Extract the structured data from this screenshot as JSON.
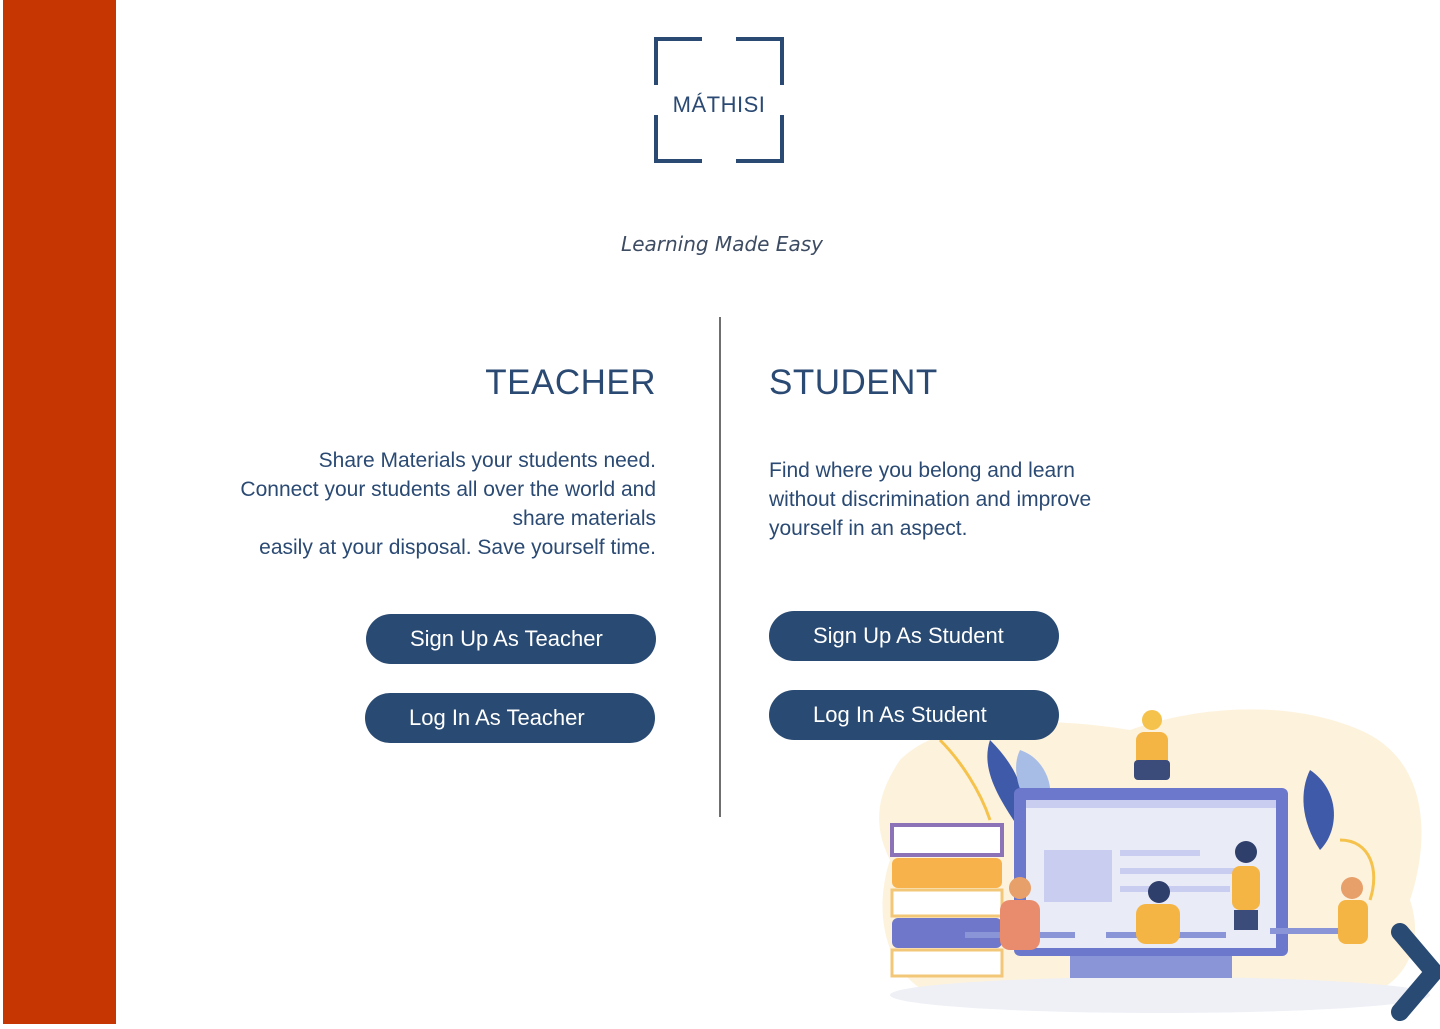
{
  "brand": {
    "logo_text": "MÁTHISI",
    "tagline": "Learning Made Easy"
  },
  "colors": {
    "accent_bar": "#c53602",
    "primary": "#294a72",
    "text": "#2b4a73"
  },
  "teacher": {
    "heading": "TEACHER",
    "description": [
      "Share Materials your students need.",
      "Connect your students all over the world and",
      "share materials",
      "easily at your disposal. Save yourself time."
    ],
    "signup_label": "Sign Up As Teacher",
    "login_label": "Log In As Teacher"
  },
  "student": {
    "heading": "STUDENT",
    "description": [
      "Find where you belong and learn",
      "without discrimination and improve",
      "yourself in an aspect."
    ],
    "signup_label": "Sign Up As Student",
    "login_label": "Log In As Student"
  },
  "icons": {
    "next": "chevron-right-icon",
    "illustration": "classroom-illustration"
  }
}
